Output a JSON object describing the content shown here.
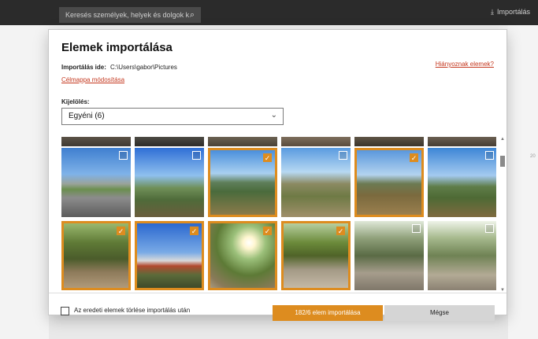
{
  "app": {
    "search_placeholder": "Keresés személyek, helyek és dolgok k",
    "import_button": "Importálás",
    "side_fragment": "20"
  },
  "dialog": {
    "title": "Elemek importálása",
    "destination_label": "Importálás ide:",
    "destination_path": "C:\\Users\\gabor\\Pictures",
    "change_folder_link": "Célmappa módosítása",
    "missing_items_link": "Hiányoznak elemek?",
    "selection_label": "Kijelölés:",
    "selection_value": "Egyéni (6)",
    "delete_originals_label": "Az eredeti elemek törlése importálás után",
    "import_button": "182/6 elem importálása",
    "cancel_button": "Mégse"
  },
  "colors": {
    "accent": "#dd8c1f",
    "link": "#c4381f"
  },
  "photos": {
    "rows": [
      [
        {
          "selected": false,
          "scene": "road"
        },
        {
          "selected": false,
          "scene": "hill-sky"
        },
        {
          "selected": true,
          "scene": "valley"
        },
        {
          "selected": false,
          "scene": "path-hill"
        },
        {
          "selected": true,
          "scene": "valley-dry"
        },
        {
          "selected": false,
          "scene": "meadow"
        }
      ],
      [
        {
          "selected": true,
          "scene": "forest-path"
        },
        {
          "selected": true,
          "scene": "village"
        },
        {
          "selected": true,
          "scene": "sun-forest"
        },
        {
          "selected": true,
          "scene": "rock-path"
        },
        {
          "selected": false,
          "scene": "woods"
        },
        {
          "selected": false,
          "scene": "woods-bright"
        }
      ]
    ]
  }
}
